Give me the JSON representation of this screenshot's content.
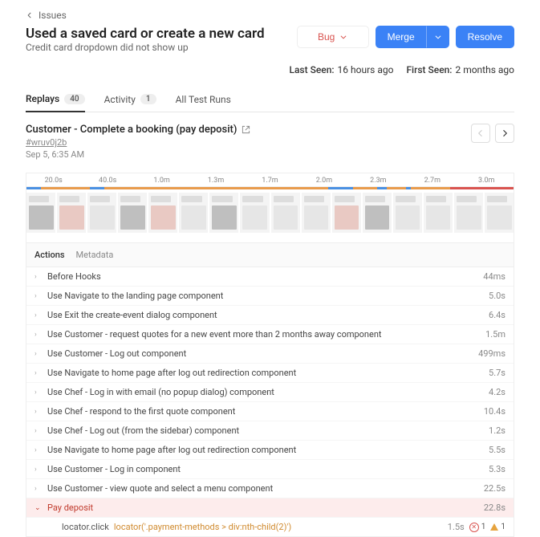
{
  "breadcrumb": {
    "back": "Issues"
  },
  "issue": {
    "title": "Used a saved card or create a new card",
    "subtitle": "Credit card dropdown did not show up"
  },
  "buttons": {
    "bug": "Bug",
    "merge": "Merge",
    "resolve": "Resolve"
  },
  "seen": {
    "last_label": "Last Seen:",
    "last_value": "16 hours ago",
    "first_label": "First Seen:",
    "first_value": "2 months ago"
  },
  "tabs": {
    "replays": "Replays",
    "replays_count": "40",
    "activity": "Activity",
    "activity_count": "1",
    "tests": "All Test Runs"
  },
  "session": {
    "title": "Customer - Complete a booking (pay deposit)",
    "id": "#wruv0j2b",
    "time": "Sep 5, 6:35 AM"
  },
  "timeline_ticks": [
    "20.0s",
    "40.0s",
    "1.0m",
    "1.3m",
    "1.7m",
    "2.0m",
    "2.3m",
    "2.7m",
    "3.0m"
  ],
  "panel_tabs": {
    "actions": "Actions",
    "metadata": "Metadata"
  },
  "actions": [
    {
      "label": "Before Hooks",
      "dur": "44ms"
    },
    {
      "label": "Use Navigate to the landing page component",
      "dur": "5.0s"
    },
    {
      "label": "Use Exit the create-event dialog component",
      "dur": "6.4s"
    },
    {
      "label": "Use Customer - request quotes for a new event more than 2 months away component",
      "dur": "1.5m"
    },
    {
      "label": "Use Customer - Log out component",
      "dur": "499ms"
    },
    {
      "label": "Use Navigate to home page after log out redirection component",
      "dur": "5.7s"
    },
    {
      "label": "Use Chef - Log in with email (no popup dialog) component",
      "dur": "4.2s"
    },
    {
      "label": "Use Chef - respond to the first quote component",
      "dur": "10.4s"
    },
    {
      "label": "Use Chef - Log out (from the sidebar) component",
      "dur": "1.2s"
    },
    {
      "label": "Use Navigate to home page after log out redirection component",
      "dur": "5.5s"
    },
    {
      "label": "Use Customer - Log in component",
      "dur": "5.3s"
    },
    {
      "label": "Use Customer - view quote and select a menu component",
      "dur": "22.5s"
    }
  ],
  "error_action": {
    "label": "Pay deposit",
    "dur": "22.8s"
  },
  "locator": {
    "call": "locator.click",
    "path": "locator('.payment-methods > div:nth-child(2)')",
    "dur": "1.5s",
    "fail_count": "1",
    "warn_count": "1"
  }
}
